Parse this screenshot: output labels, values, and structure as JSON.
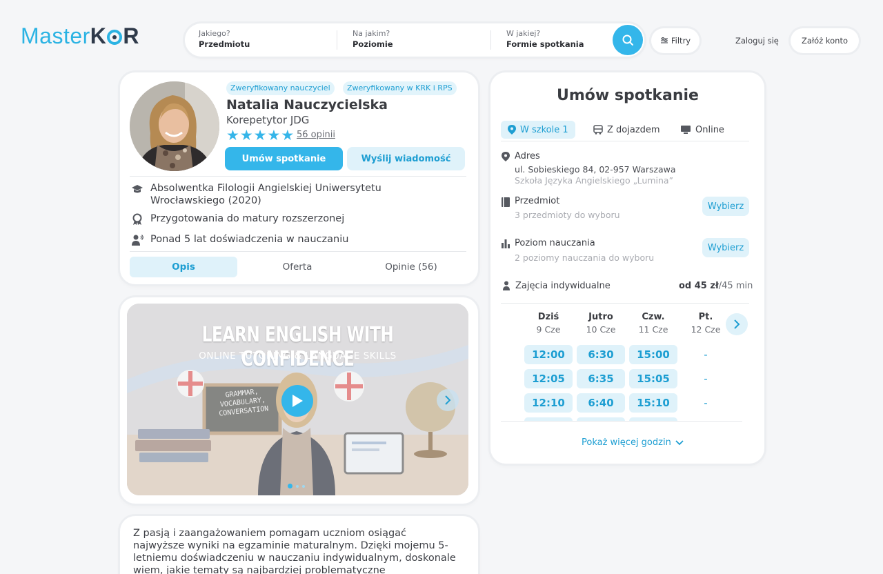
{
  "brand": {
    "part1": "Master",
    "part2": "K",
    "part3": "R"
  },
  "search": {
    "fields": [
      {
        "question": "Jakiego?",
        "value": "Przedmiotu"
      },
      {
        "question": "Na jakim?",
        "value": "Poziomie"
      },
      {
        "question": "W jakiej?",
        "value": "Formie spotkania"
      }
    ]
  },
  "header": {
    "filters": "Filtry",
    "login": "Zaloguj się",
    "register": "Załóż konto"
  },
  "profile": {
    "badges": [
      "Zweryfikowany nauczyciel",
      "Zweryfikowany w KRK i RPS"
    ],
    "name": "Natalia Nauczycielska",
    "role": "Korepetytor JDG",
    "rating": 5,
    "reviews": "56 opinii",
    "book_button": "Umów spotkanie",
    "message_button": "Wyślij wiadomość",
    "features": [
      {
        "icon": "graduation-cap-icon",
        "line1": "Absolwentka Filologii Angielskiej Uniwersytetu",
        "line2": "Wrocławskiego (2020)"
      },
      {
        "icon": "award-icon",
        "line1": "Przygotowania do matury rozszerzonej"
      },
      {
        "icon": "teacher-icon",
        "line1": "Ponad 5 lat doświadczenia w nauczaniu"
      }
    ],
    "tabs": [
      "Opis",
      "Oferta",
      "Opinie (56)"
    ]
  },
  "video": {
    "title": "LEARN ENGLISH WITH CONFIDENCE",
    "subtitle": "ONLINE TUTORING & LANGUAGE SKILLS",
    "board": [
      "GRAMMAR,",
      "VOCABULARY,",
      "CONVERSATION"
    ]
  },
  "description": "Z pasją i zaangażowaniem pomagam uczniom osiągać najwyższe wyniki na egzaminie maturalnym. Dzięki mojemu 5-letniemu doświadczeniu w nauczaniu indywidualnym, doskonale wiem, jakie tematy są najbardziej problematyczne",
  "booking": {
    "title": "Umów spotkanie",
    "modes": [
      "W szkole 1",
      "Z dojazdem",
      "Online"
    ],
    "address_label": "Adres",
    "address": "ul. Sobieskiego 84, 02-957 Warszawa",
    "school": "Szkoła Języka Angielskiego „Lumina”",
    "subject_label": "Przedmiot",
    "subject_sub": "3 przedmioty do wyboru",
    "level_label": "Poziom nauczania",
    "level_sub": "2 poziomy nauczania do wyboru",
    "choose": "Wybierz",
    "individual_label": "Zajęcia indywidualne",
    "price_prefix": "od ",
    "price": "45 zł",
    "price_suffix": "/45 min",
    "days": [
      {
        "name": "Dziś",
        "date": "9 Cze",
        "slots": [
          "12:00",
          "12:05",
          "12:10"
        ]
      },
      {
        "name": "Jutro",
        "date": "10 Cze",
        "slots": [
          "6:30",
          "6:35",
          "6:40"
        ]
      },
      {
        "name": "Czw.",
        "date": "11 Cze",
        "slots": [
          "15:00",
          "15:05",
          "15:10"
        ]
      },
      {
        "name": "Pt.",
        "date": "12 Cze",
        "slots": [
          "-",
          "-",
          "-"
        ]
      }
    ],
    "more_hours": "Pokaż więcej godzin"
  },
  "colors": {
    "accent": "#34b6ea",
    "accent_light": "#dff2fa",
    "accent_text": "#1d9ed2"
  }
}
